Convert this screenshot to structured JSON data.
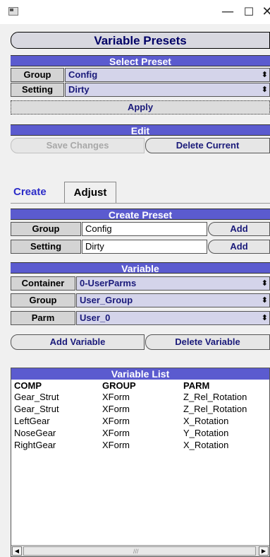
{
  "window": {
    "minimize_glyph": "—",
    "maximize_glyph": "☐",
    "close_glyph": "✕"
  },
  "app": {
    "title": "Variable Presets"
  },
  "select_preset": {
    "header": "Select Preset",
    "group_label": "Group",
    "group_value": "Config",
    "setting_label": "Setting",
    "setting_value": "Dirty",
    "apply_label": "Apply"
  },
  "edit": {
    "header": "Edit",
    "save_label": "Save Changes",
    "delete_label": "Delete Current"
  },
  "tabs": [
    {
      "label": "Create",
      "active": true
    },
    {
      "label": "Adjust",
      "active": false
    }
  ],
  "create_preset": {
    "header": "Create Preset",
    "group_label": "Group",
    "group_value": "Config",
    "group_add": "Add",
    "setting_label": "Setting",
    "setting_value": "Dirty",
    "setting_add": "Add"
  },
  "variable": {
    "header": "Variable",
    "container_label": "Container",
    "container_value": "0-UserParms",
    "group_label": "Group",
    "group_value": "User_Group",
    "parm_label": "Parm",
    "parm_value": "User_0",
    "add_label": "Add Variable",
    "delete_label": "Delete Variable"
  },
  "variable_list": {
    "header": "Variable List",
    "columns": [
      "COMP",
      "GROUP",
      "PARM"
    ],
    "rows": [
      [
        "Gear_Strut",
        "XForm",
        "Z_Rel_Rotation"
      ],
      [
        "Gear_Strut",
        "XForm",
        "Z_Rel_Rotation"
      ],
      [
        "LeftGear",
        "XForm",
        "X_Rotation"
      ],
      [
        "NoseGear",
        "XForm",
        "Y_Rotation"
      ],
      [
        "RightGear",
        "XForm",
        "X_Rotation"
      ]
    ]
  },
  "scrollbar": {
    "left_glyph": "◀",
    "right_glyph": "▶",
    "grip_glyph": "///"
  },
  "colors": {
    "section_bar": "#5b5bcf",
    "select_text": "#1a1a7a",
    "active_tab": "#2c2cc8"
  }
}
